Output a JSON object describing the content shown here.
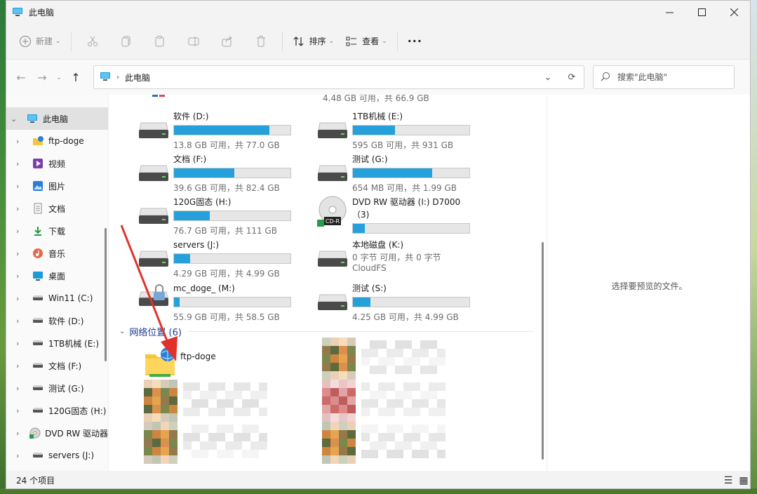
{
  "window": {
    "title": "此电脑"
  },
  "toolbar": {
    "new_label": "新建",
    "sort_label": "排序",
    "view_label": "查看",
    "more_label": "···"
  },
  "address": {
    "location": "此电脑"
  },
  "search": {
    "placeholder": "搜索\"此电脑\""
  },
  "sidebar": {
    "items": [
      {
        "label": "此电脑",
        "icon": "computer-icon"
      },
      {
        "label": "ftp-doge",
        "icon": "network-folder-icon"
      },
      {
        "label": "视频",
        "icon": "video-icon"
      },
      {
        "label": "图片",
        "icon": "pictures-icon"
      },
      {
        "label": "文档",
        "icon": "documents-icon"
      },
      {
        "label": "下载",
        "icon": "download-icon"
      },
      {
        "label": "音乐",
        "icon": "music-icon"
      },
      {
        "label": "桌面",
        "icon": "desktop-icon"
      },
      {
        "label": "Win11 (C:)",
        "icon": "drive-icon"
      },
      {
        "label": "软件 (D:)",
        "icon": "drive-icon"
      },
      {
        "label": "1TB机械 (E:)",
        "icon": "drive-icon"
      },
      {
        "label": "文档 (F:)",
        "icon": "drive-icon"
      },
      {
        "label": "测试 (G:)",
        "icon": "drive-icon"
      },
      {
        "label": "120G固态 (H:)",
        "icon": "drive-icon"
      },
      {
        "label": "DVD RW 驱动器",
        "icon": "dvd-icon"
      },
      {
        "label": "servers (J:)",
        "icon": "drive-icon"
      }
    ]
  },
  "drives": [
    {
      "name": "软件 (D:)",
      "sub": "13.8 GB 可用，共 77.0 GB",
      "used": 0.82
    },
    {
      "name": "1TB机械 (E:)",
      "sub": "595 GB 可用，共 931 GB",
      "used": 0.36
    },
    {
      "name": "文档 (F:)",
      "sub": "39.6 GB 可用，共 82.4 GB",
      "used": 0.52
    },
    {
      "name": "测试 (G:)",
      "sub": "654 MB 可用，共 1.99 GB",
      "used": 0.68
    },
    {
      "name": "120G固态 (H:)",
      "sub": "76.7 GB 可用，共 111 GB",
      "used": 0.31
    },
    {
      "name": "DVD RW 驱动器 (I:) D7000（3)",
      "sub": "",
      "used": 0.1,
      "badge": "CD-R"
    },
    {
      "name": "servers (J:)",
      "sub": "4.29 GB 可用，共 4.99 GB",
      "used": 0.14
    },
    {
      "name": "本地磁盘 (K:)",
      "sub": "0 字节 可用，共 0 字节",
      "sub2": "CloudFS"
    },
    {
      "name": "mc_doge_ (M:)",
      "sub": "55.9 GB 可用，共 58.5 GB",
      "used": 0.05
    },
    {
      "name": "测试 (S:)",
      "sub": "4.25 GB 可用，共 4.99 GB",
      "used": 0.15
    }
  ],
  "top_partial_text": "4.48 GB 可用，共 66.9 GB",
  "network_group": {
    "label": "网络位置 (6)"
  },
  "network_items": [
    {
      "name": "ftp-doge"
    }
  ],
  "preview": {
    "message": "选择要预览的文件。"
  },
  "status": {
    "count": "24 个项目"
  },
  "colors": {
    "accent": "#26a0da",
    "group_header": "#1e3b8c",
    "arrow": "#e0322b"
  }
}
